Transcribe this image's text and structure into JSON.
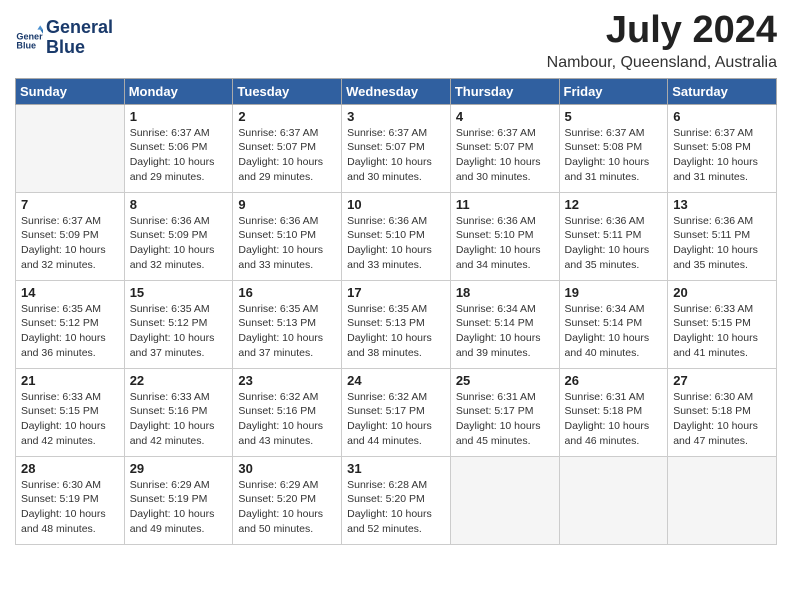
{
  "header": {
    "logo_line1": "General",
    "logo_line2": "Blue",
    "month_title": "July 2024",
    "subtitle": "Nambour, Queensland, Australia"
  },
  "days_of_week": [
    "Sunday",
    "Monday",
    "Tuesday",
    "Wednesday",
    "Thursday",
    "Friday",
    "Saturday"
  ],
  "weeks": [
    [
      {
        "day": "",
        "info": ""
      },
      {
        "day": "1",
        "info": "Sunrise: 6:37 AM\nSunset: 5:06 PM\nDaylight: 10 hours\nand 29 minutes."
      },
      {
        "day": "2",
        "info": "Sunrise: 6:37 AM\nSunset: 5:07 PM\nDaylight: 10 hours\nand 29 minutes."
      },
      {
        "day": "3",
        "info": "Sunrise: 6:37 AM\nSunset: 5:07 PM\nDaylight: 10 hours\nand 30 minutes."
      },
      {
        "day": "4",
        "info": "Sunrise: 6:37 AM\nSunset: 5:07 PM\nDaylight: 10 hours\nand 30 minutes."
      },
      {
        "day": "5",
        "info": "Sunrise: 6:37 AM\nSunset: 5:08 PM\nDaylight: 10 hours\nand 31 minutes."
      },
      {
        "day": "6",
        "info": "Sunrise: 6:37 AM\nSunset: 5:08 PM\nDaylight: 10 hours\nand 31 minutes."
      }
    ],
    [
      {
        "day": "7",
        "info": "Sunrise: 6:37 AM\nSunset: 5:09 PM\nDaylight: 10 hours\nand 32 minutes."
      },
      {
        "day": "8",
        "info": "Sunrise: 6:36 AM\nSunset: 5:09 PM\nDaylight: 10 hours\nand 32 minutes."
      },
      {
        "day": "9",
        "info": "Sunrise: 6:36 AM\nSunset: 5:10 PM\nDaylight: 10 hours\nand 33 minutes."
      },
      {
        "day": "10",
        "info": "Sunrise: 6:36 AM\nSunset: 5:10 PM\nDaylight: 10 hours\nand 33 minutes."
      },
      {
        "day": "11",
        "info": "Sunrise: 6:36 AM\nSunset: 5:10 PM\nDaylight: 10 hours\nand 34 minutes."
      },
      {
        "day": "12",
        "info": "Sunrise: 6:36 AM\nSunset: 5:11 PM\nDaylight: 10 hours\nand 35 minutes."
      },
      {
        "day": "13",
        "info": "Sunrise: 6:36 AM\nSunset: 5:11 PM\nDaylight: 10 hours\nand 35 minutes."
      }
    ],
    [
      {
        "day": "14",
        "info": "Sunrise: 6:35 AM\nSunset: 5:12 PM\nDaylight: 10 hours\nand 36 minutes."
      },
      {
        "day": "15",
        "info": "Sunrise: 6:35 AM\nSunset: 5:12 PM\nDaylight: 10 hours\nand 37 minutes."
      },
      {
        "day": "16",
        "info": "Sunrise: 6:35 AM\nSunset: 5:13 PM\nDaylight: 10 hours\nand 37 minutes."
      },
      {
        "day": "17",
        "info": "Sunrise: 6:35 AM\nSunset: 5:13 PM\nDaylight: 10 hours\nand 38 minutes."
      },
      {
        "day": "18",
        "info": "Sunrise: 6:34 AM\nSunset: 5:14 PM\nDaylight: 10 hours\nand 39 minutes."
      },
      {
        "day": "19",
        "info": "Sunrise: 6:34 AM\nSunset: 5:14 PM\nDaylight: 10 hours\nand 40 minutes."
      },
      {
        "day": "20",
        "info": "Sunrise: 6:33 AM\nSunset: 5:15 PM\nDaylight: 10 hours\nand 41 minutes."
      }
    ],
    [
      {
        "day": "21",
        "info": "Sunrise: 6:33 AM\nSunset: 5:15 PM\nDaylight: 10 hours\nand 42 minutes."
      },
      {
        "day": "22",
        "info": "Sunrise: 6:33 AM\nSunset: 5:16 PM\nDaylight: 10 hours\nand 42 minutes."
      },
      {
        "day": "23",
        "info": "Sunrise: 6:32 AM\nSunset: 5:16 PM\nDaylight: 10 hours\nand 43 minutes."
      },
      {
        "day": "24",
        "info": "Sunrise: 6:32 AM\nSunset: 5:17 PM\nDaylight: 10 hours\nand 44 minutes."
      },
      {
        "day": "25",
        "info": "Sunrise: 6:31 AM\nSunset: 5:17 PM\nDaylight: 10 hours\nand 45 minutes."
      },
      {
        "day": "26",
        "info": "Sunrise: 6:31 AM\nSunset: 5:18 PM\nDaylight: 10 hours\nand 46 minutes."
      },
      {
        "day": "27",
        "info": "Sunrise: 6:30 AM\nSunset: 5:18 PM\nDaylight: 10 hours\nand 47 minutes."
      }
    ],
    [
      {
        "day": "28",
        "info": "Sunrise: 6:30 AM\nSunset: 5:19 PM\nDaylight: 10 hours\nand 48 minutes."
      },
      {
        "day": "29",
        "info": "Sunrise: 6:29 AM\nSunset: 5:19 PM\nDaylight: 10 hours\nand 49 minutes."
      },
      {
        "day": "30",
        "info": "Sunrise: 6:29 AM\nSunset: 5:20 PM\nDaylight: 10 hours\nand 50 minutes."
      },
      {
        "day": "31",
        "info": "Sunrise: 6:28 AM\nSunset: 5:20 PM\nDaylight: 10 hours\nand 52 minutes."
      },
      {
        "day": "",
        "info": ""
      },
      {
        "day": "",
        "info": ""
      },
      {
        "day": "",
        "info": ""
      }
    ]
  ]
}
